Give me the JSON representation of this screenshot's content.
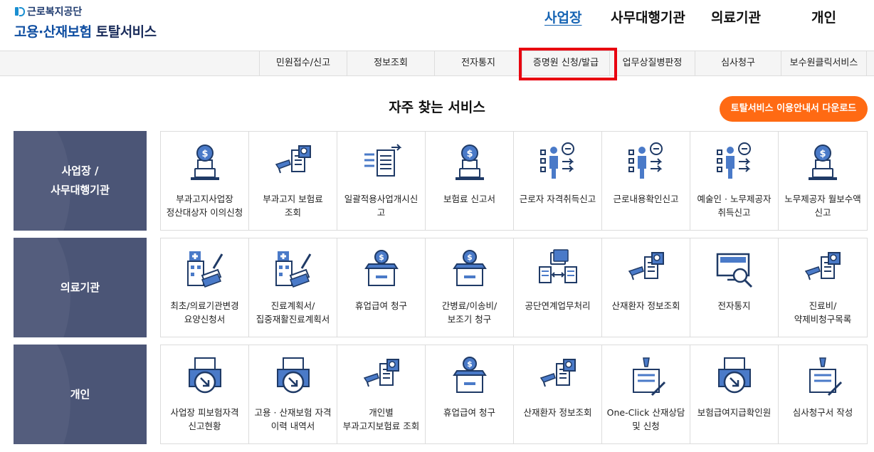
{
  "header": {
    "org_name": "근로복지공단",
    "title_main": "고용·산재보험",
    "title_sub": "토탈서비스"
  },
  "top_nav": [
    {
      "label": "사업장",
      "active": true
    },
    {
      "label": "사무대행기관",
      "active": false
    },
    {
      "label": "의료기관",
      "active": false
    },
    {
      "label": "개인",
      "active": false
    }
  ],
  "sub_nav": [
    {
      "label": "민원접수/신고"
    },
    {
      "label": "정보조회"
    },
    {
      "label": "전자통지"
    },
    {
      "label": "증명원 신청/발급",
      "highlighted": true
    },
    {
      "label": "업무상질병판정"
    },
    {
      "label": "심사청구"
    },
    {
      "label": "보수원클릭서비스"
    }
  ],
  "section_title": "자주 찾는 서비스",
  "guide_button": "토탈서비스 이용안내서 다운로드",
  "colors": {
    "accent_blue": "#1563b3",
    "category_bg": "#4b5576",
    "guide_button_bg": "#ff6a13",
    "highlight_red": "#e8000f",
    "icon_blue": "#4a7ac8"
  },
  "categories": [
    {
      "label_line1": "사업장 /",
      "label_line2": "사무대행기관",
      "services": [
        {
          "label": "부과고지사업장 정산대상자 이의신청",
          "icon": "money-laptop-icon"
        },
        {
          "label": "부과고지 보험료 조회",
          "icon": "document-search-icon"
        },
        {
          "label": "일괄적용사업개시신고",
          "icon": "document-transfer-icon"
        },
        {
          "label": "보험료 신고서",
          "icon": "money-laptop-icon"
        },
        {
          "label": "근로자 자격취득신고",
          "icon": "person-checklist-icon"
        },
        {
          "label": "근로내용확인신고",
          "icon": "person-checklist-icon"
        },
        {
          "label": "예술인 · 노무제공자 취득신고",
          "icon": "person-checklist-icon"
        },
        {
          "label": "노무제공자 월보수액 신고",
          "icon": "money-laptop-icon"
        }
      ]
    },
    {
      "label_line1": "의료기관",
      "label_line2": "",
      "services": [
        {
          "label": "최초/의료기관변경 요양신청서",
          "icon": "hospital-document-icon"
        },
        {
          "label": "진료계획서/집중재활진료계획서",
          "icon": "hospital-document-icon"
        },
        {
          "label": "휴업급여 청구",
          "icon": "money-box-icon"
        },
        {
          "label": "간병료/이송비/보조기 청구",
          "icon": "money-box-icon"
        },
        {
          "label": "공단연계업무처리",
          "icon": "folder-exchange-icon"
        },
        {
          "label": "산재환자 정보조회",
          "icon": "document-search-icon"
        },
        {
          "label": "전자통지",
          "icon": "monitor-search-icon"
        },
        {
          "label": "진료비/약제비청구목록",
          "icon": "document-search-icon"
        }
      ]
    },
    {
      "label_line1": "개인",
      "label_line2": "",
      "services": [
        {
          "label": "사업장 피보험자격 신고현황",
          "icon": "printer-arrow-icon"
        },
        {
          "label": "고용 · 산재보험 자격 이력 내역서",
          "icon": "printer-arrow-icon"
        },
        {
          "label": "개인별 부과고지보험료 조회",
          "icon": "document-search-icon"
        },
        {
          "label": "휴업급여 청구",
          "icon": "money-box-icon"
        },
        {
          "label": "산재환자 정보조회",
          "icon": "document-search-icon"
        },
        {
          "label": "One-Click 산재상담 및 신청",
          "icon": "pen-document-icon"
        },
        {
          "label": "보험급여지급확인원",
          "icon": "printer-arrow-icon"
        },
        {
          "label": "심사청구서 작성",
          "icon": "pen-document-icon"
        }
      ]
    }
  ]
}
